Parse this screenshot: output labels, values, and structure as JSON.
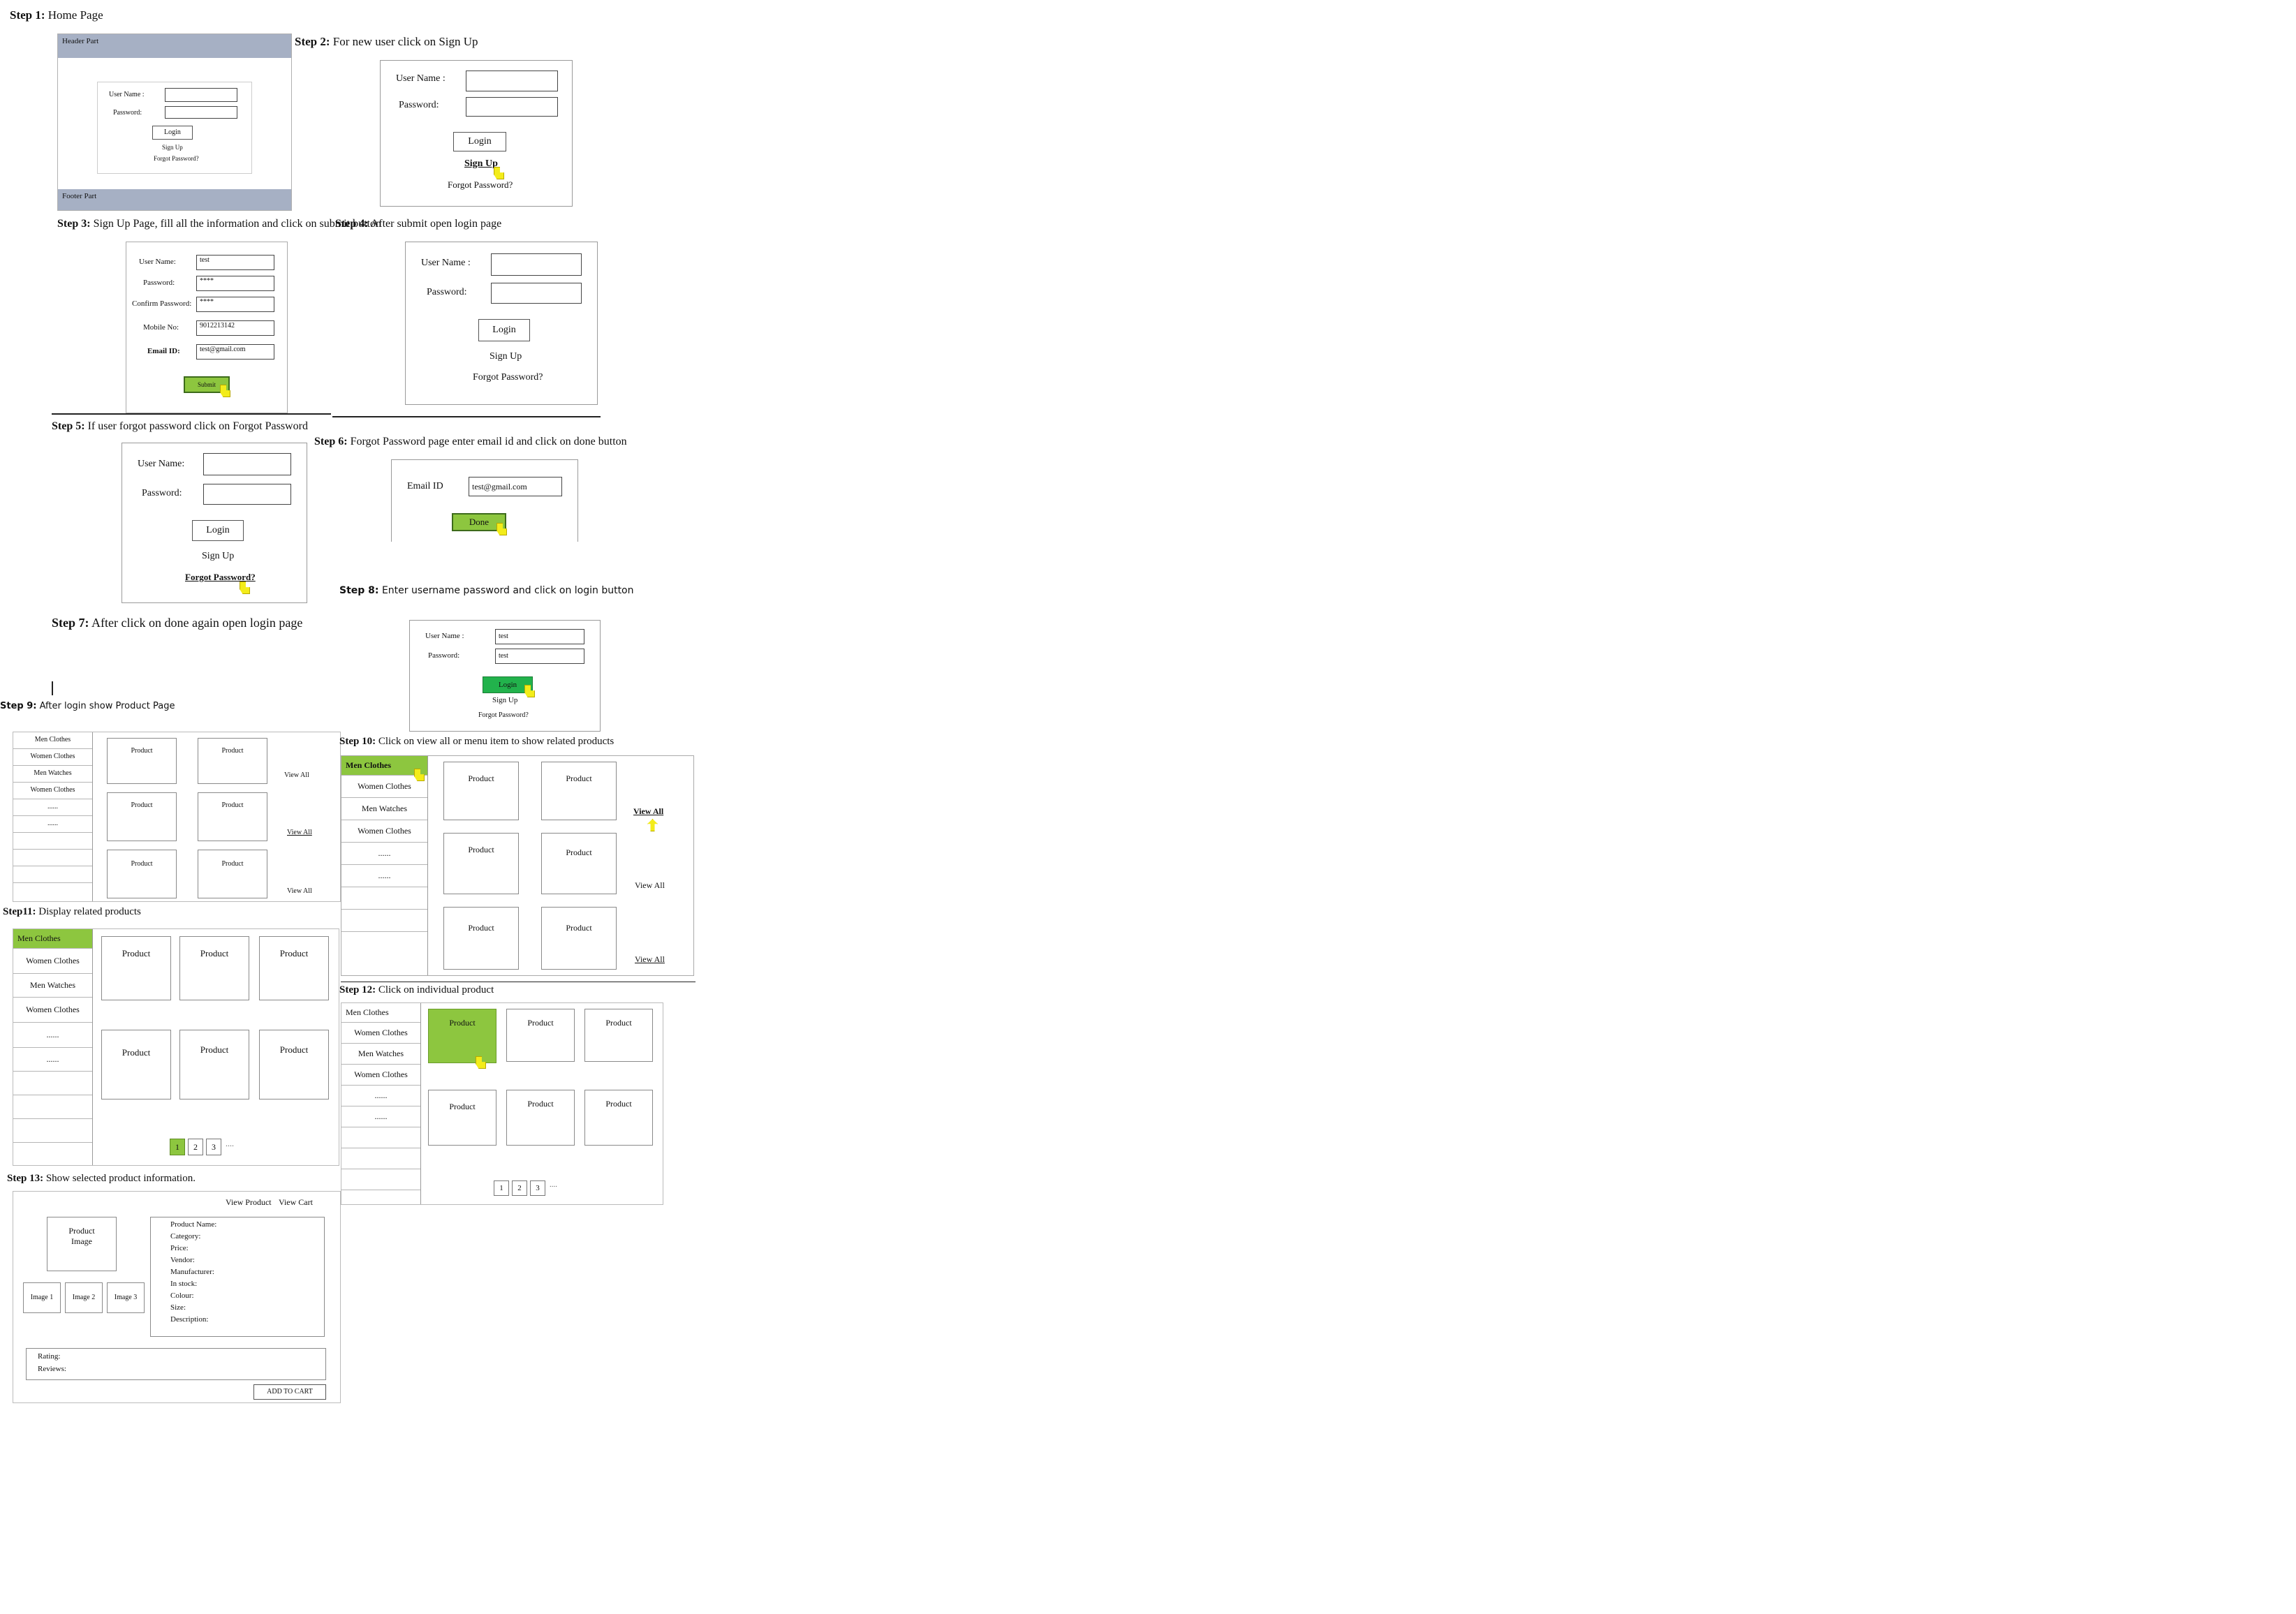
{
  "colors": {
    "accent_green": "#8dc63f",
    "login_green": "#22b24c",
    "header_blue": "#a6b0c4",
    "cursor_yellow": "#f3ec1a"
  },
  "step1": {
    "num": "Step 1:",
    "text": " Home Page",
    "header": "Header Part",
    "footer": "Footer Part",
    "username_label": "User Name :",
    "password_label": "Password:",
    "login": "Login",
    "signup": "Sign Up",
    "forgot": "Forgot Password?"
  },
  "step2": {
    "num": "Step 2:",
    "text": " For new user click on Sign Up",
    "username_label": "User Name :",
    "password_label": "Password:",
    "login": "Login",
    "signup": "Sign Up",
    "forgot": "Forgot Password?"
  },
  "step3": {
    "num": "Step 3:",
    "text": " Sign Up Page, fill all the information and click on submit button",
    "fields": [
      {
        "label": "User Name:",
        "value": "test"
      },
      {
        "label": "Password:",
        "value": "****"
      },
      {
        "label": "Confirm Password:",
        "value": "****"
      },
      {
        "label": "Mobile No:",
        "value": "9012213142"
      },
      {
        "label": "Email ID:",
        "value": "test@gmail.com"
      }
    ],
    "submit": "Submit"
  },
  "step4": {
    "num": "Step 4:",
    "text": " After submit open login page",
    "username_label": "User Name :",
    "password_label": "Password:",
    "login": "Login",
    "signup": "Sign Up",
    "forgot": "Forgot Password?"
  },
  "step5": {
    "num": "Step 5:",
    "text": " If user forgot password click on Forgot Password",
    "username_label": "User Name:",
    "password_label": "Password:",
    "login": "Login",
    "signup": "Sign Up",
    "forgot": "Forgot Password?"
  },
  "step6": {
    "num": "Step 6:",
    "text": " Forgot Password page enter email id and click on done button",
    "email_label": "Email ID",
    "email_value": "test@gmail.com",
    "done": "Done"
  },
  "step7": {
    "num": "Step 7:",
    "text": " After click on done again open login page"
  },
  "step8": {
    "num": "Step 8:",
    "text": " Enter username password and click on login button",
    "username_label": "User Name :",
    "password_label": "Password:",
    "username_value": "test",
    "password_value": "test",
    "login": "Login",
    "signup": "Sign Up",
    "forgot": "Forgot Password?"
  },
  "step9": {
    "num": "Step 9:",
    "text": " After login show Product Page",
    "menu": [
      "Men Clothes",
      "Women Clothes",
      "Men Watches",
      "Women Clothes",
      "......",
      "......"
    ],
    "product": "Product",
    "view_all": "View All"
  },
  "step10": {
    "num": "Step 10:",
    "text": " Click on view all or menu item to show related products",
    "menu": [
      "Men Clothes",
      "Women Clothes",
      "Men Watches",
      "Women Clothes",
      "......",
      "......"
    ],
    "product": "Product",
    "view_all": "View All"
  },
  "step11": {
    "num": "Step11:",
    "text": " Display related products",
    "menu": [
      "Men Clothes",
      "Women Clothes",
      "Men Watches",
      "Women Clothes",
      "......",
      "......"
    ],
    "product": "Product",
    "pages": [
      "1",
      "2",
      "3"
    ],
    "more": "...."
  },
  "step12": {
    "num": "Step 12:",
    "text": " Click on individual product",
    "menu": [
      "Men Clothes",
      "Women Clothes",
      "Men Watches",
      "Women Clothes",
      "......",
      "......"
    ],
    "product": "Product",
    "pages": [
      "1",
      "2",
      "3"
    ],
    "more": "...."
  },
  "step13": {
    "num": "Step 13:",
    "text": " Show selected product information.",
    "view_product": "View Product",
    "view_cart": "View Cart",
    "product_image": "Product Image",
    "images": [
      "Image 1",
      "Image 2",
      "Image 3"
    ],
    "details": [
      "Product Name:",
      "Category:",
      "Price:",
      "Vendor:",
      "Manufacturer:",
      "In stock:",
      "Colour:",
      "Size:",
      "Description:"
    ],
    "rating": "Rating:",
    "reviews": "Reviews:",
    "add_to_cart": "ADD TO CART"
  }
}
